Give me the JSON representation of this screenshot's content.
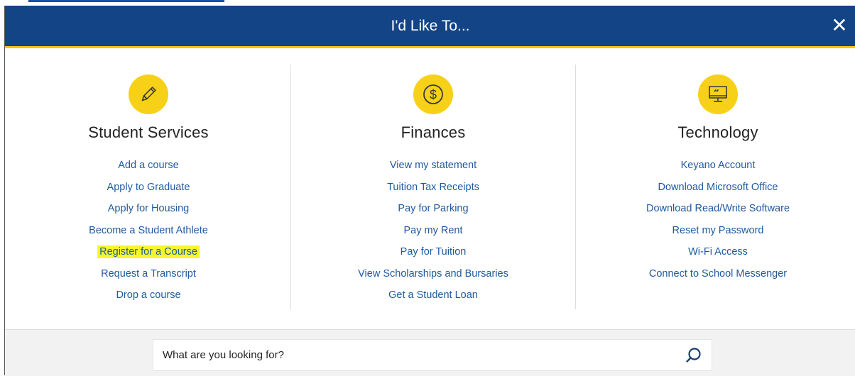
{
  "modal": {
    "title": "I'd Like To...",
    "close_symbol": "✕"
  },
  "columns": [
    {
      "icon": "pencil-icon",
      "heading": "Student Services",
      "links": [
        "Add a course",
        "Apply to Graduate",
        "Apply for Housing",
        "Become a Student Athlete",
        "Register for a Course",
        "Request a Transcript",
        "Drop a course"
      ]
    },
    {
      "icon": "dollar-icon",
      "heading": "Finances",
      "links": [
        "View my statement",
        "Tuition Tax Receipts",
        "Pay for Parking",
        "Pay my Rent",
        "Pay for Tuition",
        "View Scholarships and Bursaries",
        "Get a Student Loan"
      ]
    },
    {
      "icon": "computer-monitor-icon",
      "heading": "Technology",
      "links": [
        "Keyano Account",
        "Download Microsoft Office",
        "Download Read/Write Software",
        "Reset my Password",
        "Wi-Fi Access",
        "Connect to School Messenger"
      ]
    }
  ],
  "search": {
    "placeholder": "What are you looking for?",
    "icon": "search-icon"
  },
  "colors": {
    "header": "#134485",
    "accent": "#f7c600",
    "icon_circle": "#f7d117",
    "link": "#1f5aa0",
    "highlight": "#f8f52a"
  }
}
